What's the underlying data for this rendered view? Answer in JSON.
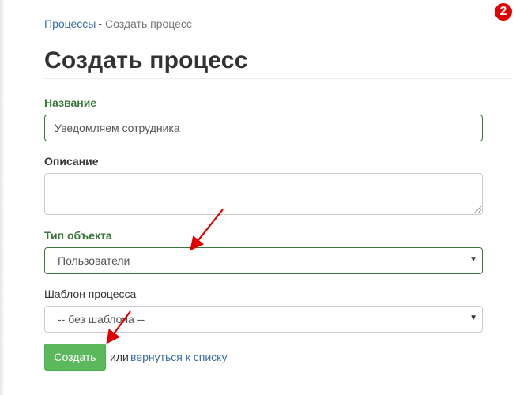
{
  "step_badge": "2",
  "breadcrumb": {
    "parent": "Процессы",
    "separator": "-",
    "current": "Создать процесс"
  },
  "page_title": "Создать процесс",
  "form": {
    "name": {
      "label": "Название",
      "value": "Уведомляем сотрудника"
    },
    "description": {
      "label": "Описание",
      "value": ""
    },
    "object_type": {
      "label": "Тип объекта",
      "value": "Пользователи"
    },
    "template": {
      "label": "Шаблон процесса",
      "value": "-- без шаблона --"
    }
  },
  "actions": {
    "create_label": "Создать",
    "or_text": "или",
    "back_link": "вернуться к списку"
  },
  "colors": {
    "success": "#3c763d",
    "button": "#5cb85c",
    "link": "#3a6ea5",
    "annotation": "#e00000"
  },
  "icons": {
    "select_caret": "caret-down-icon"
  }
}
